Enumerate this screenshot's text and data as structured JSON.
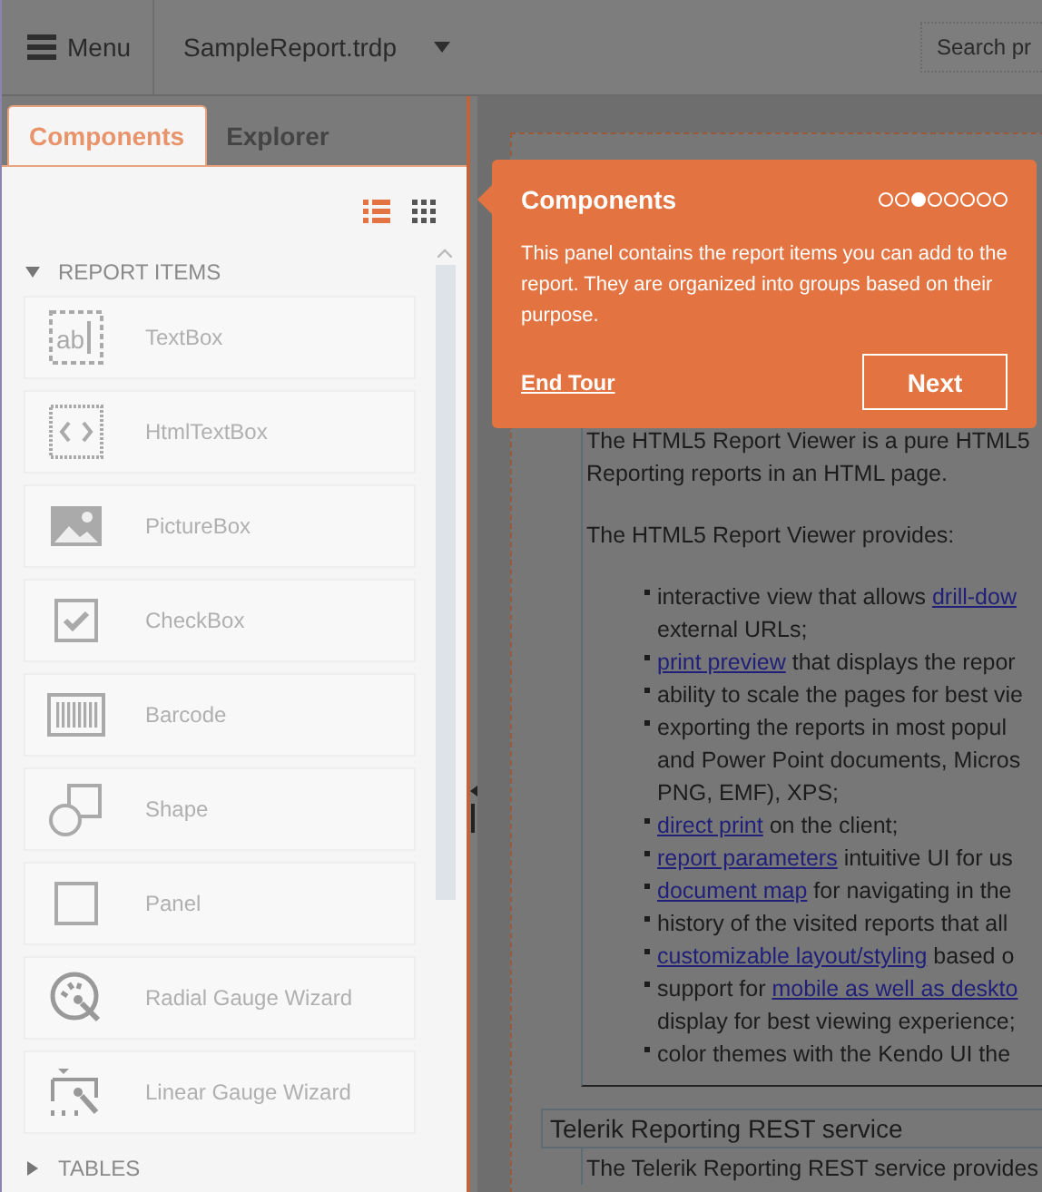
{
  "header": {
    "menu_label": "Menu",
    "file_name": "SampleReport.trdp",
    "search": {
      "placeholder": "Search pr"
    }
  },
  "tabs": [
    {
      "label": "Components",
      "selected": true
    },
    {
      "label": "Explorer",
      "selected": false
    }
  ],
  "view_toggles": [
    {
      "kind": "list",
      "selected": true
    },
    {
      "kind": "grid",
      "selected": false
    }
  ],
  "sections": [
    {
      "title": "REPORT ITEMS",
      "expanded": true,
      "items": [
        {
          "kind": "textbox",
          "label": "TextBox",
          "icon_text": "ab"
        },
        {
          "kind": "htmltextbox",
          "label": "HtmlTextBox"
        },
        {
          "kind": "picturebox",
          "label": "PictureBox"
        },
        {
          "kind": "checkbox",
          "label": "CheckBox"
        },
        {
          "kind": "barcode",
          "label": "Barcode"
        },
        {
          "kind": "shape",
          "label": "Shape"
        },
        {
          "kind": "panel",
          "label": "Panel"
        },
        {
          "kind": "radialgauge",
          "label": "Radial Gauge Wizard"
        },
        {
          "kind": "lineargauge",
          "label": "Linear Gauge Wizard"
        }
      ]
    },
    {
      "title": "TABLES",
      "expanded": false
    }
  ],
  "tour": {
    "title": "Components",
    "steps": [
      {
        "selected": false
      },
      {
        "selected": false
      },
      {
        "selected": true
      },
      {
        "selected": false
      },
      {
        "selected": false
      },
      {
        "selected": false
      },
      {
        "selected": false
      },
      {
        "selected": false
      }
    ],
    "body": "This panel contains the report items you can add to the report. They are organized into groups based on their purpose.",
    "end_label": "End Tour",
    "next_label": "Next"
  },
  "report": {
    "intro_lines": [
      "The HTML5 Report Viewer is a pure HTML5",
      "Reporting reports in an HTML page."
    ],
    "provides": "The HTML5 Report Viewer provides:",
    "bullets": [
      {
        "lines": [
          [
            {
              "text": "interactive view that allows ",
              "link": false
            },
            {
              "text": "drill-dow",
              "link": true
            }
          ],
          [
            {
              "text": "external URLs;",
              "link": false
            }
          ]
        ]
      },
      {
        "lines": [
          [
            {
              "text": "print preview",
              "link": true
            },
            {
              "text": " that displays the repor",
              "link": false
            }
          ]
        ]
      },
      {
        "lines": [
          [
            {
              "text": "ability to scale the pages for best vie",
              "link": false
            }
          ]
        ]
      },
      {
        "lines": [
          [
            {
              "text": "exporting the reports in most popul",
              "link": false
            }
          ],
          [
            {
              "text": "and Power Point documents, Micros",
              "link": false
            }
          ],
          [
            {
              "text": "PNG, EMF), XPS;",
              "link": false
            }
          ]
        ]
      },
      {
        "lines": [
          [
            {
              "text": "direct print",
              "link": true
            },
            {
              "text": " on the client;",
              "link": false
            }
          ]
        ]
      },
      {
        "lines": [
          [
            {
              "text": "report parameters",
              "link": true
            },
            {
              "text": " intuitive UI for us",
              "link": false
            }
          ]
        ]
      },
      {
        "lines": [
          [
            {
              "text": "document map",
              "link": true
            },
            {
              "text": " for navigating in the",
              "link": false
            }
          ]
        ]
      },
      {
        "lines": [
          [
            {
              "text": "history of the visited reports that all",
              "link": false
            }
          ]
        ]
      },
      {
        "lines": [
          [
            {
              "text": "customizable layout/styling",
              "link": true
            },
            {
              "text": " based o",
              "link": false
            }
          ]
        ]
      },
      {
        "lines": [
          [
            {
              "text": "support for ",
              "link": false
            },
            {
              "text": "mobile as well as deskto",
              "link": true
            }
          ],
          [
            {
              "text": "display for best viewing experience;",
              "link": false
            }
          ]
        ]
      },
      {
        "lines": [
          [
            {
              "text": "color themes with the Kendo UI the",
              "link": false
            }
          ]
        ]
      }
    ],
    "rest_heading": "Telerik Reporting REST service",
    "rest_body": "The Telerik Reporting REST service provides"
  }
}
